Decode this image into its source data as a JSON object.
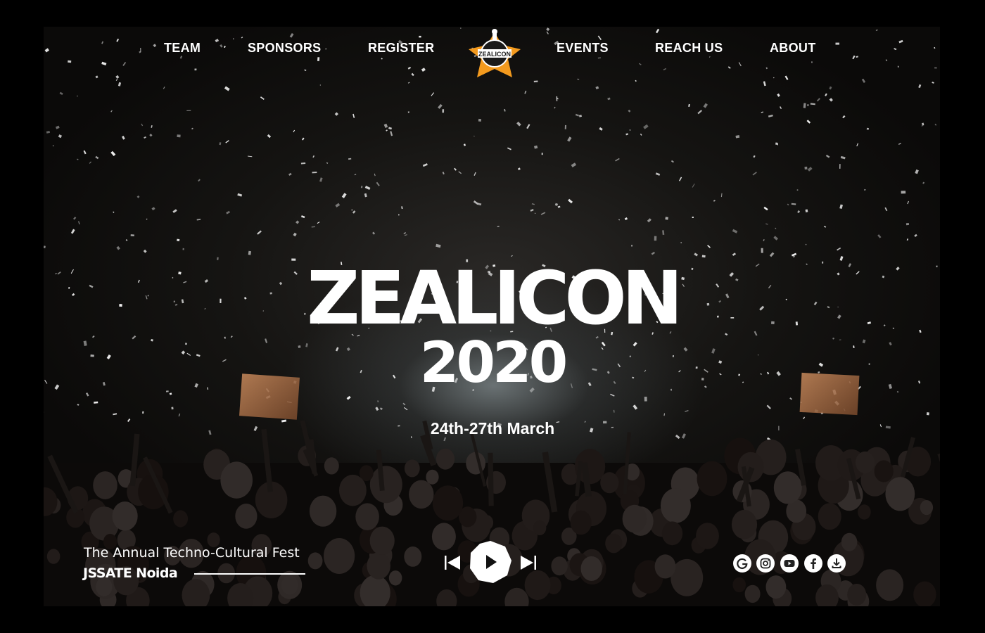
{
  "nav": {
    "left_items": [
      {
        "label": "TEAM"
      },
      {
        "label": "SPONSORS"
      },
      {
        "label": "REGISTER"
      }
    ],
    "right_items": [
      {
        "label": "EVENTS"
      },
      {
        "label": "REACH US"
      },
      {
        "label": "ABOUT"
      }
    ],
    "logo_text": "ZEALICON"
  },
  "hero": {
    "title": "ZEALICON",
    "year": "2020",
    "dates": "24th-27th March"
  },
  "footer": {
    "tagline": "The Annual Techno-Cultural Fest",
    "college": "JSSATE Noida"
  },
  "player": {
    "controls": [
      {
        "icon": "skip-previous-icon"
      },
      {
        "icon": "play-icon"
      },
      {
        "icon": "skip-next-icon"
      }
    ]
  },
  "social": [
    {
      "icon": "google-icon"
    },
    {
      "icon": "instagram-icon"
    },
    {
      "icon": "youtube-icon"
    },
    {
      "icon": "facebook-icon"
    },
    {
      "icon": "download-icon"
    }
  ],
  "colors": {
    "background": "#000000",
    "text": "#ffffff",
    "logo_accent": "#f39a1e"
  }
}
